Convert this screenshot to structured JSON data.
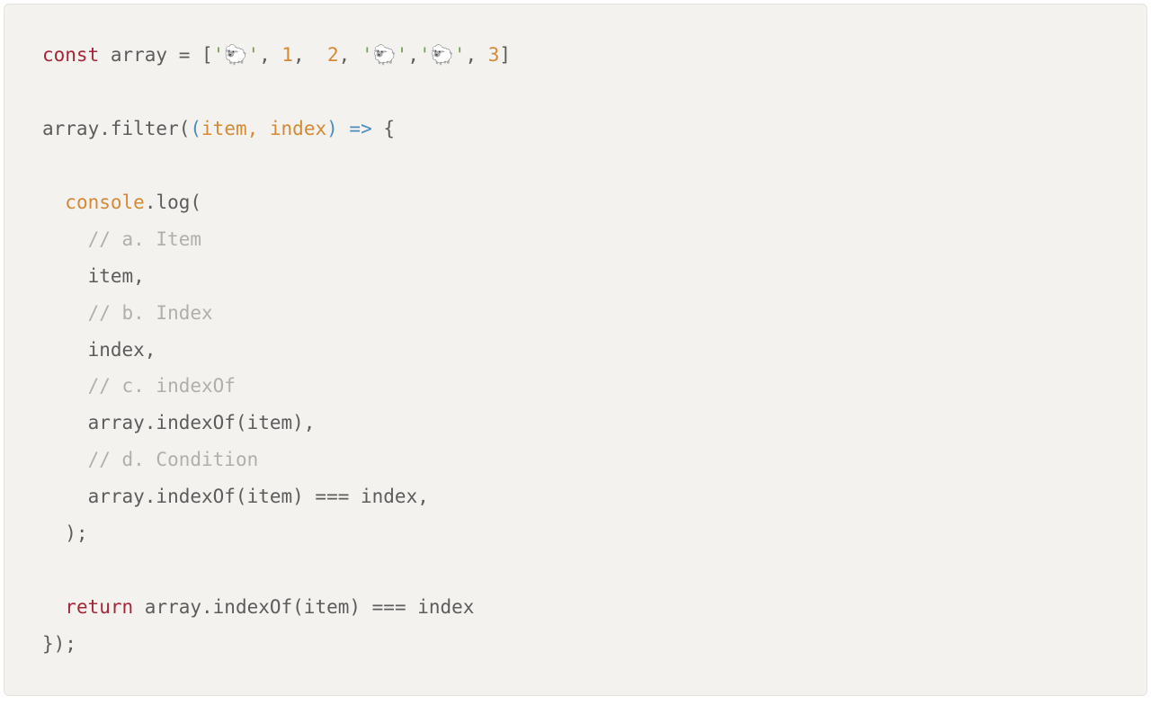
{
  "code": {
    "tokens": [
      [
        {
          "t": "const",
          "c": "tok-keyword"
        },
        {
          "t": " array = [",
          "c": "tok-default"
        },
        {
          "t": "'🐑'",
          "c": "tok-string"
        },
        {
          "t": ", ",
          "c": "tok-default"
        },
        {
          "t": "1",
          "c": "tok-number"
        },
        {
          "t": ",  ",
          "c": "tok-default"
        },
        {
          "t": "2",
          "c": "tok-number"
        },
        {
          "t": ", ",
          "c": "tok-default"
        },
        {
          "t": "'🐑'",
          "c": "tok-string"
        },
        {
          "t": ",",
          "c": "tok-default"
        },
        {
          "t": "'🐑'",
          "c": "tok-string"
        },
        {
          "t": ", ",
          "c": "tok-default"
        },
        {
          "t": "3",
          "c": "tok-number"
        },
        {
          "t": "]",
          "c": "tok-default"
        }
      ],
      [],
      [
        {
          "t": "array.filter(",
          "c": "tok-default"
        },
        {
          "t": "(",
          "c": "tok-paren"
        },
        {
          "t": "item, index",
          "c": "tok-param"
        },
        {
          "t": ")",
          "c": "tok-paren"
        },
        {
          "t": " ",
          "c": "tok-default"
        },
        {
          "t": "=>",
          "c": "tok-arrow"
        },
        {
          "t": " {",
          "c": "tok-default"
        }
      ],
      [],
      [
        {
          "t": "  ",
          "c": "tok-default"
        },
        {
          "t": "console",
          "c": "tok-builtin"
        },
        {
          "t": ".log(",
          "c": "tok-default"
        }
      ],
      [
        {
          "t": "    ",
          "c": "tok-default"
        },
        {
          "t": "// a. Item",
          "c": "tok-comment"
        }
      ],
      [
        {
          "t": "    item,",
          "c": "tok-default"
        }
      ],
      [
        {
          "t": "    ",
          "c": "tok-default"
        },
        {
          "t": "// b. Index",
          "c": "tok-comment"
        }
      ],
      [
        {
          "t": "    index,",
          "c": "tok-default"
        }
      ],
      [
        {
          "t": "    ",
          "c": "tok-default"
        },
        {
          "t": "// c. indexOf",
          "c": "tok-comment"
        }
      ],
      [
        {
          "t": "    array.indexOf(item),",
          "c": "tok-default"
        }
      ],
      [
        {
          "t": "    ",
          "c": "tok-default"
        },
        {
          "t": "// d. Condition",
          "c": "tok-comment"
        }
      ],
      [
        {
          "t": "    array.indexOf(item) === index,",
          "c": "tok-default"
        }
      ],
      [
        {
          "t": "  );",
          "c": "tok-default"
        }
      ],
      [],
      [
        {
          "t": "  ",
          "c": "tok-default"
        },
        {
          "t": "return",
          "c": "tok-keyword"
        },
        {
          "t": " array.indexOf(item) === index",
          "c": "tok-default"
        }
      ],
      [
        {
          "t": "});",
          "c": "tok-default"
        }
      ]
    ]
  }
}
